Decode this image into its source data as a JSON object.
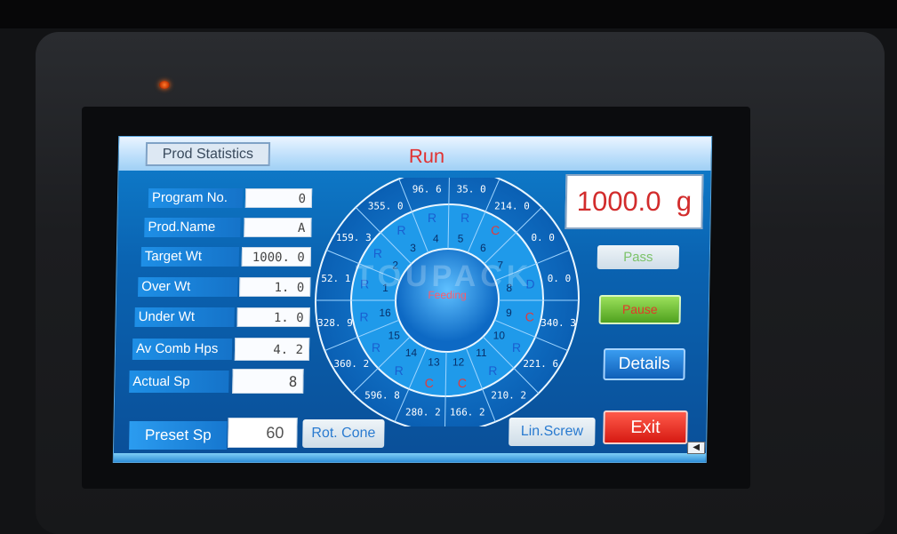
{
  "screen": {
    "title": "Run",
    "prod_statistics_label": "Prod Statistics",
    "watermark": "TOUPACK"
  },
  "fields": [
    {
      "label": "Program No.",
      "value": "0"
    },
    {
      "label": "Prod.Name",
      "value": "A"
    },
    {
      "label": "Target Wt",
      "value": "1000. 0"
    },
    {
      "label": "Over Wt",
      "value": "1. 0"
    },
    {
      "label": "Under Wt",
      "value": "1. 0"
    },
    {
      "label": "Av Comb Hps",
      "value": "4. 2"
    },
    {
      "label": "Actual Sp",
      "value": "8"
    }
  ],
  "preset": {
    "label": "Preset Sp",
    "value": "60"
  },
  "weight_display": "1000.0  g",
  "buttons": {
    "pass": "Pass",
    "pause": "Pause",
    "details": "Details",
    "exit": "Exit",
    "rot_cone": "Rot. Cone",
    "lin_screw": "Lin.Screw"
  },
  "dial": {
    "center_label": "Feeding",
    "outer_values": [
      "35. 0",
      "214. 0",
      "0. 0",
      "0. 0",
      "340. 3",
      "221. 6",
      "210. 2",
      "166. 2",
      "280. 2",
      "596. 8",
      "360. 2",
      "328. 9",
      "52. 1",
      "159. 3",
      "355. 0",
      "96. 6"
    ],
    "inner_hoppers": [
      {
        "number": "5",
        "status": "R"
      },
      {
        "number": "6",
        "status": "C"
      },
      {
        "number": "7",
        "status": ""
      },
      {
        "number": "8",
        "status": "D"
      },
      {
        "number": "9",
        "status": "C"
      },
      {
        "number": "10",
        "status": "R"
      },
      {
        "number": "11",
        "status": "R"
      },
      {
        "number": "12",
        "status": "C"
      },
      {
        "number": "13",
        "status": "C"
      },
      {
        "number": "14",
        "status": "R"
      },
      {
        "number": "15",
        "status": "R"
      },
      {
        "number": "16",
        "status": "R"
      },
      {
        "number": "1",
        "status": "R"
      },
      {
        "number": "2",
        "status": "R"
      },
      {
        "number": "3",
        "status": "R"
      },
      {
        "number": "4",
        "status": "R"
      }
    ]
  },
  "colors": {
    "status_R": "#1a5fd0",
    "status_C": "#e23a3a",
    "status_D": "#1a5fd0",
    "accent": "#0f7fce"
  }
}
